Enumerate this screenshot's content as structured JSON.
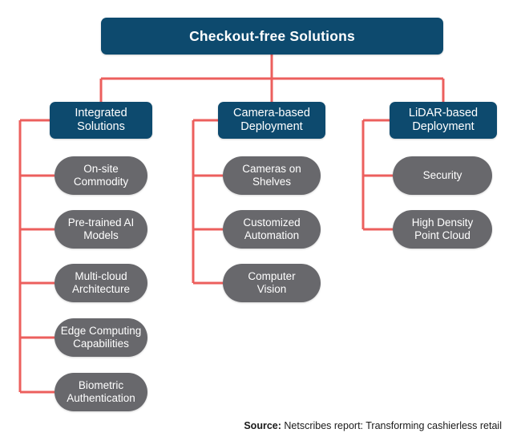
{
  "diagram": {
    "title": "Checkout-free  Solutions",
    "branches": [
      {
        "header": "Integrated\nSolutions",
        "header_line1": "Integrated",
        "header_line2": "Solutions",
        "children": [
          {
            "line1": "On-site",
            "line2": "Commodity"
          },
          {
            "line1": "Pre-trained AI",
            "line2": "Models"
          },
          {
            "line1": "Multi-cloud",
            "line2": "Architecture"
          },
          {
            "line1": "Edge Computing",
            "line2": "Capabilities"
          },
          {
            "line1": "Biometric",
            "line2": "Authentication"
          }
        ]
      },
      {
        "header": "Camera-based\nDeployment",
        "header_line1": "Camera-based",
        "header_line2": "Deployment",
        "children": [
          {
            "line1": "Cameras on",
            "line2": "Shelves"
          },
          {
            "line1": "Customized",
            "line2": "Automation"
          },
          {
            "line1": "Computer",
            "line2": "Vision"
          }
        ]
      },
      {
        "header": "LiDAR-based\nDeployment",
        "header_line1": "LiDAR-based",
        "header_line2": "Deployment",
        "children": [
          {
            "line1": "Security",
            "line2": ""
          },
          {
            "line1": "High Density",
            "line2": "Point Cloud"
          }
        ]
      }
    ]
  },
  "footer": {
    "source_label": "Source:",
    "source_text": " Netscribes report: Transforming cashierless retail"
  },
  "colors": {
    "navy": "#0d4a6e",
    "gray": "#68686c",
    "connector_red": "#ec5f5d",
    "background": "#ffffff",
    "text_on_fill": "#ffffff",
    "footer_text": "#1a1a1a"
  }
}
